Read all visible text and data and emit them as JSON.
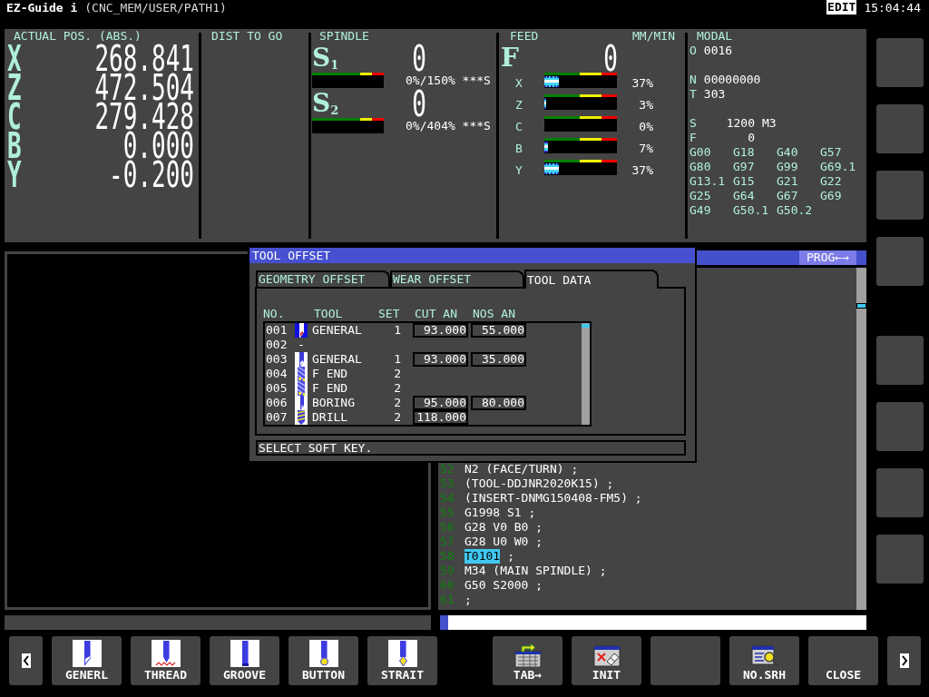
{
  "header": {
    "title": "EZ-Guide i",
    "path": "(CNC_MEM/USER/PATH1)",
    "mode": "EDIT",
    "time": "15:04:44"
  },
  "position": {
    "title": "ACTUAL POS. (ABS.)",
    "axes": [
      {
        "axis": "X",
        "value": "268.841"
      },
      {
        "axis": "Z",
        "value": "472.504"
      },
      {
        "axis": "C",
        "value": "279.428"
      },
      {
        "axis": "B",
        "value": "0.000"
      },
      {
        "axis": "Y",
        "value": "-0.200"
      }
    ]
  },
  "distance_to_go": {
    "title": "DIST TO GO"
  },
  "spindle": {
    "title": "SPINDLE",
    "spindles": [
      {
        "name": "S$_{1}$",
        "value": "0",
        "level": 0,
        "reading": "0%/150% ***S"
      },
      {
        "name": "S$_{2}$",
        "value": "0",
        "level": 0,
        "reading": "0%/404% ***S"
      }
    ]
  },
  "feed": {
    "title": "FEED",
    "unit": "MM/MIN",
    "name": "F",
    "value": "0",
    "axes": [
      {
        "axis": "X",
        "level": 0.2,
        "reading": "37%"
      },
      {
        "axis": "Z",
        "level": 0.025,
        "reading": "3%"
      },
      {
        "axis": "C",
        "level": 0,
        "reading": "0%"
      },
      {
        "axis": "B",
        "level": 0.05,
        "reading": "7%"
      },
      {
        "axis": "Y",
        "level": 0.2,
        "reading": "37%"
      }
    ]
  },
  "modal": {
    "title": "MODAL",
    "groups": [
      [
        {
          "kind": "word",
          "label": "O",
          "value": "0016"
        }
      ],
      [
        {
          "kind": "word",
          "label": "N",
          "value": "00000000"
        },
        {
          "kind": "word",
          "label": "T",
          "value": "303"
        }
      ],
      [
        {
          "kind": "rate",
          "label": "S",
          "value": "1200",
          "unit": "M3"
        },
        {
          "kind": "rate",
          "label": "F",
          "value": "0"
        }
      ]
    ],
    "g_codes": [
      "G00",
      "G18",
      "G40",
      "G57",
      "G80",
      "G97",
      "G99",
      "G69.1",
      "G13.1",
      "G15",
      "G21",
      "G22",
      "G25",
      "G64",
      "G67",
      "G69",
      "G49",
      "G50.1",
      "G50.2"
    ]
  },
  "program": {
    "title": "PROG←→",
    "lines": [
      {
        "number": "52",
        "code": "N2 (FACE/TURN) ;"
      },
      {
        "number": "53",
        "code": "(TOOL-DDJNR2020K15) ;"
      },
      {
        "number": "54",
        "code": "(INSERT-DNMG150408-FM5) ;"
      },
      {
        "number": "55",
        "code": "G1998 S1 ;"
      },
      {
        "number": "56",
        "code": "G28 V0 B0 ;"
      },
      {
        "number": "57",
        "code": "G28 U0 W0 ;"
      },
      {
        "number": "58",
        "cursor": "T0101",
        "code": ";"
      },
      {
        "number": "59",
        "code": "M34 (MAIN SPINDLE) ;"
      },
      {
        "number": "60",
        "code": "G50 S2000 ;"
      },
      {
        "number": "61",
        "code": ";"
      }
    ]
  },
  "tool_offset": {
    "title": "TOOL OFFSET",
    "tabs": [
      {
        "label": "GEOMETRY OFFSET",
        "selected": false
      },
      {
        "label": "WEAR OFFSET",
        "selected": false
      },
      {
        "label": "TOOL DATA",
        "selected": true
      }
    ],
    "columns": [
      "NO.",
      "TOOL",
      "SET",
      "CUT AN",
      "NOS AN"
    ],
    "rows": [
      {
        "no": "001",
        "kind": "general",
        "tool": "GENERAL",
        "set": "1",
        "cut_an": "93.000",
        "nos_an": "55.000",
        "selected": true
      },
      {
        "no": "002",
        "kind": "none",
        "tool": "-",
        "selected": false
      },
      {
        "no": "003",
        "kind": "general",
        "tool": "GENERAL",
        "set": "1",
        "cut_an": "93.000",
        "nos_an": "35.000",
        "selected": false
      },
      {
        "no": "004",
        "kind": "f_end",
        "tool": "F END",
        "set": "2",
        "selected": false
      },
      {
        "no": "005",
        "kind": "f_end",
        "tool": "F END",
        "set": "2",
        "selected": false
      },
      {
        "no": "006",
        "kind": "boring",
        "tool": "BORING",
        "set": "2",
        "cut_an": "95.000",
        "nos_an": "80.000",
        "selected": false
      },
      {
        "no": "007",
        "kind": "drill",
        "tool": "DRILL",
        "set": "2",
        "cut_an": "118.000",
        "selected": false
      }
    ],
    "message": "SELECT SOFT KEY."
  },
  "soft_key_groups": [
    {
      "keys": [
        {
          "kind": "prev"
        },
        {
          "kind": "general",
          "label": "GENERL"
        },
        {
          "kind": "thread",
          "label": "THREAD"
        },
        {
          "kind": "groove",
          "label": "GROOVE"
        },
        {
          "kind": "button",
          "label": "BUTTON"
        },
        {
          "kind": "strait",
          "label": "STRAIT"
        }
      ]
    },
    {
      "keys": [
        {
          "kind": "table",
          "label": "TAB→"
        },
        {
          "kind": "init",
          "label": "INIT"
        },
        {
          "kind": "blank"
        },
        {
          "kind": "search",
          "label": "NO.SRH"
        },
        {
          "kind": "plain",
          "label": "CLOSE"
        },
        {
          "kind": "next"
        }
      ]
    }
  ]
}
